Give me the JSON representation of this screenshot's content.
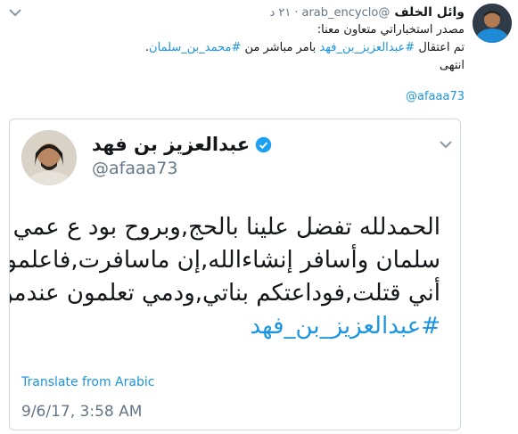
{
  "tweet": {
    "author_name": "وائل الخلف",
    "handle": "@arab_encyclo",
    "time": "٢١ د",
    "lines": [
      "مصدر استخباراتي متعاون معنا:",
      "تم اعتقال",
      "#عبدالعزيز_بن_فهد",
      "بامر مباشر من",
      "#محمد_بن_سلمان",
      ".",
      "انتهى"
    ],
    "mention": "@afaaa73"
  },
  "quoted": {
    "name": "عبدالعزيز بن فهد",
    "handle": "@afaaa73",
    "lines": [
      "الحمدلله تفضل علينا بالحج,وبروح بود ع عمي",
      "سلمان وأسافر إنشاءالله,إن ماسافرت,فاعلموا",
      "أني قتلت,فوداعتكم بناتي,ودمي تعلمون عندمن؟"
    ],
    "hashtag": "#عبدالعزيز_بن_فهد",
    "translate_label": "Translate from Arabic",
    "date": "9/6/17, 3:58 AM"
  },
  "colors": {
    "link": "#1b95e0",
    "muted": "#657786",
    "verified": "#1da1f2"
  },
  "icons": [
    "chevron-down-icon",
    "verified-badge-icon"
  ]
}
